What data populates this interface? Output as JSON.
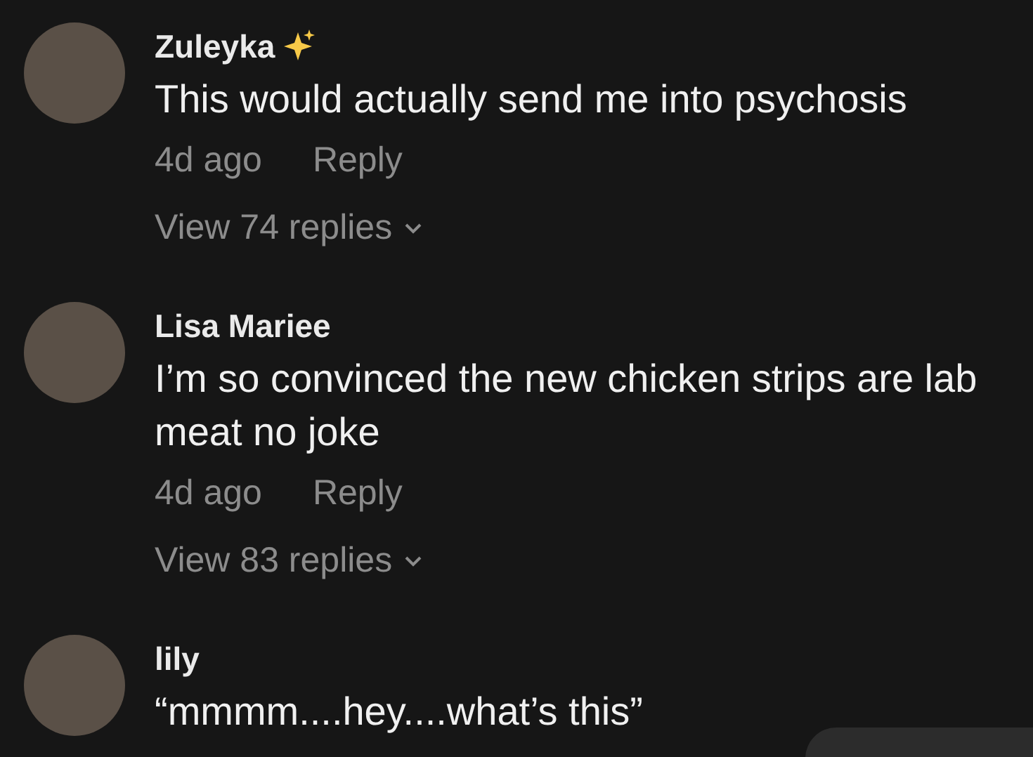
{
  "comments": [
    {
      "author": "Zuleyka",
      "sparkle": true,
      "text": "This would actually send me into psychosis",
      "time": "4d ago",
      "reply": "Reply",
      "view_replies": "View 74 replies"
    },
    {
      "author": "Lisa Mariee",
      "sparkle": false,
      "text": "I’m so convinced the new chicken strips are lab meat no joke",
      "time": "4d ago",
      "reply": "Reply",
      "view_replies": "View 83 replies"
    },
    {
      "author": "lily",
      "sparkle": false,
      "text": "“mmmm....hey....what’s this”"
    }
  ]
}
